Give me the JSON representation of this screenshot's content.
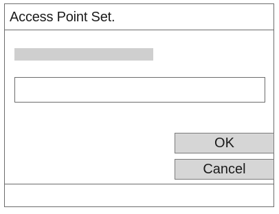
{
  "dialog": {
    "title": "Access Point Set.",
    "input_value": "",
    "ok_label": "OK",
    "cancel_label": "Cancel"
  },
  "colors": {
    "border": "#6b6b6b",
    "button_bg": "#d6d6d6",
    "placeholder_bar": "#cfcfcf",
    "background": "#ffffff"
  }
}
